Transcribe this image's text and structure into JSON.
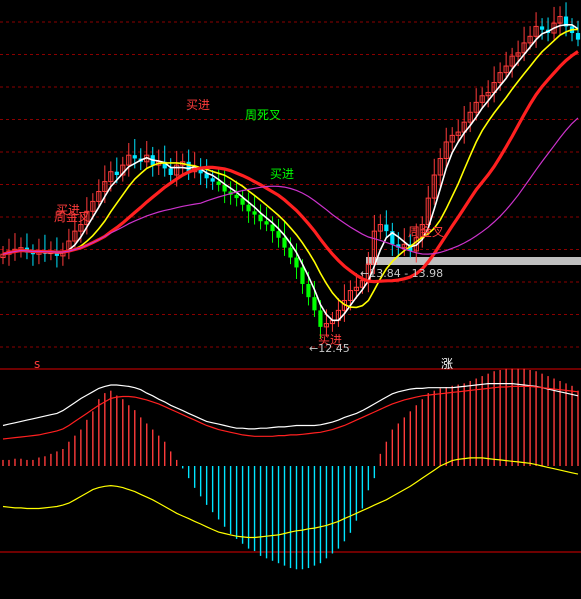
{
  "chart_data": [
    {
      "type": "candlestick",
      "panel": "price",
      "colors": {
        "background": "#000000",
        "up": "#ff3b3b",
        "down": "#00e5ff",
        "down_alt": "#00ff00",
        "ma_white": "#ffffff",
        "ma_yellow": "#ffff00",
        "ma_red_thick": "#ff2020",
        "ma_magenta": "#cc33cc",
        "grid": "#8b0000",
        "band": "#bfbfbf"
      },
      "annotations": {
        "price_range": "13.84 - 13.98",
        "low_price": "12.45",
        "buy_1": "买进",
        "golden_cross_1": "周金叉",
        "buy_2": "买进",
        "death_cross": "周死叉",
        "buy_3": "买进",
        "buy_4": "买进",
        "golden_cross_2": "周金叉",
        "marker_s": "s",
        "marker_rise": "涨"
      },
      "x": [
        0,
        1,
        2,
        3,
        4,
        5,
        6,
        7,
        8,
        9,
        10,
        11,
        12,
        13,
        14,
        15,
        16,
        17,
        18,
        19,
        20,
        21,
        22,
        23,
        24,
        25,
        26,
        27,
        28,
        29,
        30,
        31,
        32,
        33,
        34,
        35,
        36,
        37,
        38,
        39,
        40,
        41,
        42,
        43,
        44,
        45,
        46,
        47,
        48,
        49,
        50,
        51,
        52,
        53,
        54,
        55,
        56,
        57,
        58,
        59,
        60,
        61,
        62,
        63,
        64,
        65,
        66,
        67,
        68,
        69,
        70,
        71,
        72,
        73,
        74,
        75,
        76,
        77,
        78,
        79,
        80,
        81,
        82,
        83,
        84,
        85,
        86,
        87,
        88,
        89,
        90,
        91,
        92,
        93,
        94,
        95,
        96
      ],
      "series": [
        {
          "name": "",
          "close": [
            14.9,
            15.0,
            15.05,
            15.1,
            14.95,
            14.9,
            15.0,
            14.92,
            14.98,
            14.85,
            15.0,
            15.3,
            15.6,
            15.8,
            16.2,
            16.5,
            16.8,
            17.1,
            17.4,
            17.3,
            17.6,
            17.9,
            17.8,
            17.7,
            17.9,
            17.6,
            17.7,
            17.5,
            17.3,
            17.6,
            17.7,
            17.4,
            17.5,
            17.35,
            17.2,
            17.1,
            17.0,
            16.8,
            16.7,
            16.6,
            16.4,
            16.2,
            16.1,
            15.9,
            15.8,
            15.6,
            15.4,
            15.1,
            14.8,
            14.5,
            14.0,
            13.6,
            13.2,
            12.7,
            12.8,
            12.9,
            13.2,
            13.5,
            13.8,
            13.9,
            14.1,
            14.6,
            15.6,
            15.8,
            15.6,
            15.2,
            15.1,
            15.2,
            15.0,
            15.4,
            15.8,
            16.6,
            17.3,
            17.8,
            18.3,
            18.5,
            18.6,
            18.9,
            19.2,
            19.5,
            19.7,
            19.8,
            20.1,
            20.4,
            20.6,
            20.9,
            21.0,
            21.3,
            21.5,
            21.8,
            21.7,
            21.6,
            21.9,
            22.1,
            21.8,
            21.6,
            21.4
          ]
        }
      ]
    },
    {
      "type": "bar",
      "panel": "macd",
      "x": [
        0,
        1,
        2,
        3,
        4,
        5,
        6,
        7,
        8,
        9,
        10,
        11,
        12,
        13,
        14,
        15,
        16,
        17,
        18,
        19,
        20,
        21,
        22,
        23,
        24,
        25,
        26,
        27,
        28,
        29,
        30,
        31,
        32,
        33,
        34,
        35,
        36,
        37,
        38,
        39,
        40,
        41,
        42,
        43,
        44,
        45,
        46,
        47,
        48,
        49,
        50,
        51,
        52,
        53,
        54,
        55,
        56,
        57,
        58,
        59,
        60,
        61,
        62,
        63,
        64,
        65,
        66,
        67,
        68,
        69,
        70,
        71,
        72,
        73,
        74,
        75,
        76,
        77,
        78,
        79,
        80,
        81,
        82,
        83,
        84,
        85,
        86,
        87,
        88,
        89,
        90,
        91,
        92,
        93,
        94,
        95,
        96
      ],
      "series": [
        {
          "name": "",
          "values": [
            0.05,
            0.05,
            0.06,
            0.06,
            0.05,
            0.05,
            0.07,
            0.08,
            0.1,
            0.12,
            0.14,
            0.2,
            0.25,
            0.3,
            0.38,
            0.45,
            0.55,
            0.6,
            0.62,
            0.58,
            0.55,
            0.5,
            0.46,
            0.4,
            0.35,
            0.3,
            0.25,
            0.2,
            0.12,
            0.05,
            -0.02,
            -0.1,
            -0.18,
            -0.25,
            -0.32,
            -0.38,
            -0.44,
            -0.5,
            -0.56,
            -0.6,
            -0.64,
            -0.68,
            -0.7,
            -0.74,
            -0.76,
            -0.78,
            -0.8,
            -0.82,
            -0.84,
            -0.85,
            -0.85,
            -0.84,
            -0.82,
            -0.8,
            -0.76,
            -0.72,
            -0.68,
            -0.62,
            -0.55,
            -0.45,
            -0.35,
            -0.2,
            -0.1,
            0.1,
            0.2,
            0.3,
            0.35,
            0.4,
            0.45,
            0.5,
            0.55,
            0.6,
            0.62,
            0.64,
            0.65,
            0.66,
            0.67,
            0.68,
            0.7,
            0.72,
            0.74,
            0.76,
            0.78,
            0.79,
            0.8,
            0.8,
            0.8,
            0.8,
            0.79,
            0.78,
            0.76,
            0.74,
            0.72,
            0.7,
            0.68,
            0.66,
            0.62
          ]
        },
        {
          "name": "",
          "values": [
            0.6,
            0.62,
            0.64,
            0.66,
            0.68,
            0.7,
            0.72,
            0.74,
            0.76,
            0.78,
            0.82,
            0.88,
            0.94,
            1.0,
            1.05,
            1.1,
            1.15,
            1.18,
            1.2,
            1.2,
            1.19,
            1.18,
            1.16,
            1.13,
            1.08,
            1.04,
            0.99,
            0.95,
            0.9,
            0.86,
            0.82,
            0.78,
            0.74,
            0.7,
            0.66,
            0.64,
            0.62,
            0.6,
            0.58,
            0.56,
            0.56,
            0.55,
            0.55,
            0.56,
            0.56,
            0.57,
            0.58,
            0.58,
            0.59,
            0.6,
            0.6,
            0.6,
            0.6,
            0.61,
            0.63,
            0.65,
            0.68,
            0.72,
            0.75,
            0.78,
            0.82,
            0.87,
            0.92,
            0.97,
            1.02,
            1.07,
            1.1,
            1.12,
            1.14,
            1.15,
            1.15,
            1.16,
            1.16,
            1.16,
            1.16,
            1.16,
            1.17,
            1.18,
            1.19,
            1.2,
            1.21,
            1.22,
            1.22,
            1.22,
            1.22,
            1.22,
            1.21,
            1.2,
            1.19,
            1.18,
            1.16,
            1.14,
            1.12,
            1.1,
            1.08,
            1.06,
            1.04
          ]
        },
        {
          "name": "",
          "values": [
            0.4,
            0.41,
            0.42,
            0.43,
            0.44,
            0.45,
            0.46,
            0.48,
            0.5,
            0.52,
            0.55,
            0.6,
            0.66,
            0.72,
            0.78,
            0.84,
            0.9,
            0.95,
            1.0,
            1.02,
            1.03,
            1.03,
            1.02,
            1.0,
            0.98,
            0.95,
            0.92,
            0.88,
            0.84,
            0.8,
            0.76,
            0.72,
            0.68,
            0.64,
            0.6,
            0.57,
            0.54,
            0.52,
            0.5,
            0.48,
            0.46,
            0.45,
            0.44,
            0.44,
            0.44,
            0.44,
            0.45,
            0.45,
            0.46,
            0.46,
            0.47,
            0.48,
            0.49,
            0.5,
            0.52,
            0.54,
            0.57,
            0.6,
            0.64,
            0.68,
            0.72,
            0.76,
            0.8,
            0.84,
            0.88,
            0.92,
            0.95,
            0.98,
            1.0,
            1.02,
            1.04,
            1.05,
            1.06,
            1.07,
            1.08,
            1.09,
            1.1,
            1.11,
            1.12,
            1.13,
            1.14,
            1.15,
            1.16,
            1.17,
            1.17,
            1.18,
            1.18,
            1.18,
            1.18,
            1.17,
            1.16,
            1.15,
            1.14,
            1.13,
            1.12,
            1.11,
            1.1
          ]
        },
        {
          "name": "",
          "values": [
            -0.6,
            -0.61,
            -0.62,
            -0.62,
            -0.63,
            -0.63,
            -0.63,
            -0.62,
            -0.61,
            -0.6,
            -0.58,
            -0.55,
            -0.5,
            -0.45,
            -0.4,
            -0.35,
            -0.32,
            -0.3,
            -0.29,
            -0.3,
            -0.32,
            -0.35,
            -0.38,
            -0.42,
            -0.46,
            -0.5,
            -0.55,
            -0.6,
            -0.65,
            -0.7,
            -0.74,
            -0.78,
            -0.82,
            -0.86,
            -0.9,
            -0.94,
            -0.98,
            -1.0,
            -1.02,
            -1.04,
            -1.05,
            -1.06,
            -1.06,
            -1.05,
            -1.04,
            -1.03,
            -1.02,
            -1.0,
            -0.98,
            -0.96,
            -0.95,
            -0.93,
            -0.92,
            -0.9,
            -0.88,
            -0.85,
            -0.82,
            -0.78,
            -0.74,
            -0.7,
            -0.66,
            -0.62,
            -0.58,
            -0.54,
            -0.5,
            -0.45,
            -0.4,
            -0.35,
            -0.3,
            -0.24,
            -0.18,
            -0.12,
            -0.06,
            0.0,
            0.04,
            0.08,
            0.1,
            0.11,
            0.12,
            0.12,
            0.12,
            0.11,
            0.1,
            0.09,
            0.08,
            0.07,
            0.06,
            0.05,
            0.04,
            0.02,
            0.0,
            -0.02,
            -0.04,
            -0.06,
            -0.08,
            -0.1,
            -0.12
          ]
        }
      ]
    }
  ]
}
